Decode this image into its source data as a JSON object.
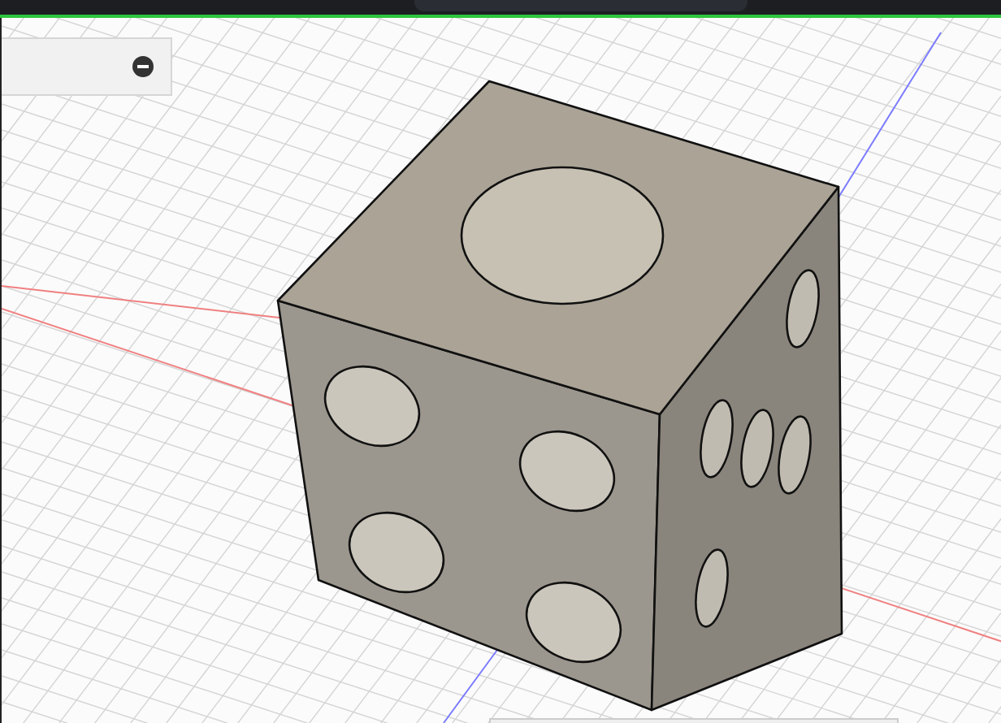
{
  "browser_panel": {
    "expanded": true
  }
}
